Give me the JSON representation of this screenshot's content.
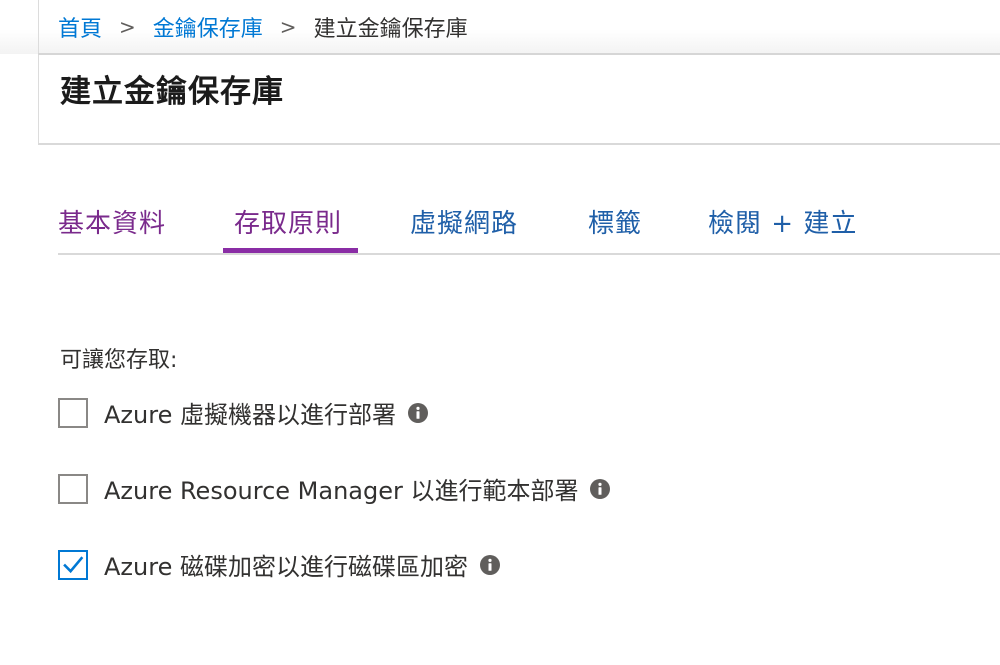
{
  "breadcrumb": {
    "home": "首頁",
    "key_vaults": "金鑰保存庫",
    "current": "建立金鑰保存庫",
    "separator": ">"
  },
  "page": {
    "title": "建立金鑰保存庫"
  },
  "tabs": [
    {
      "label": "基本資料",
      "state": "visited"
    },
    {
      "label": "存取原則",
      "state": "active"
    },
    {
      "label": "虛擬網路",
      "state": "normal"
    },
    {
      "label": "標籤",
      "state": "normal"
    },
    {
      "label": "檢閱 + 建立",
      "state": "normal"
    }
  ],
  "access": {
    "label": "可讓您存取:",
    "options": [
      {
        "label": "Azure 虛擬機器以進行部署",
        "checked": false,
        "icon": "info-icon"
      },
      {
        "label": "Azure Resource Manager 以進行範本部署",
        "checked": false,
        "icon": "info-icon"
      },
      {
        "label": "Azure 磁碟加密以進行磁碟區加密",
        "checked": true,
        "icon": "info-icon"
      }
    ]
  },
  "colors": {
    "link": "#0078d4",
    "visited_tab": "#7a2a8c",
    "active_tab_underline": "#8a2da5",
    "checkbox_checked": "#0078d4"
  }
}
